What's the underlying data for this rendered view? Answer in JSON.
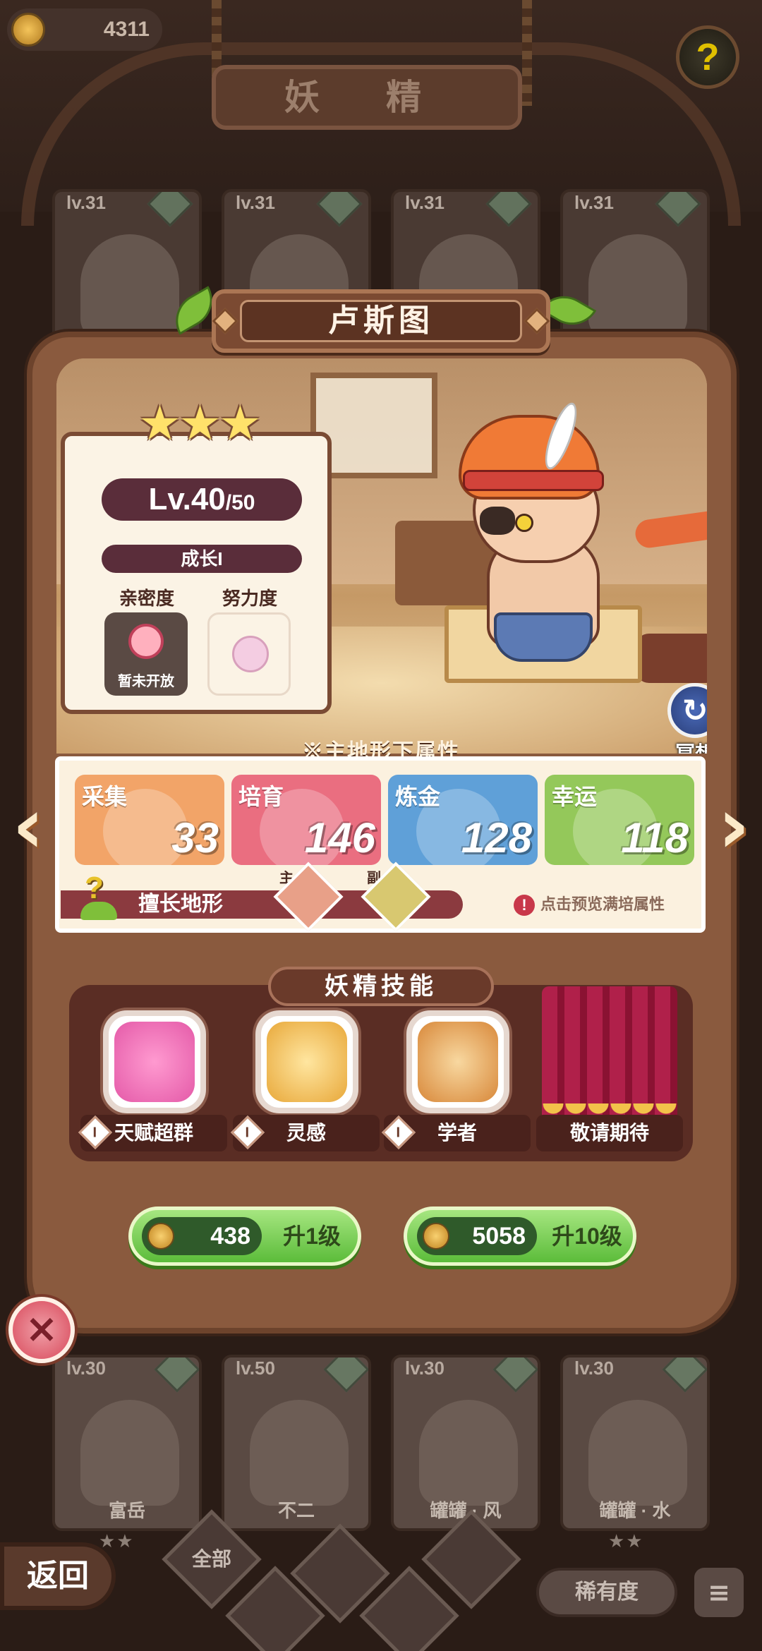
{
  "header": {
    "coins": "4311",
    "title": "妖 精",
    "help_icon": "question-sprout-icon"
  },
  "background_cards_top": [
    {
      "level": "lv.31"
    },
    {
      "level": "lv.31"
    },
    {
      "level": "lv.31"
    },
    {
      "level": "lv.31"
    }
  ],
  "background_cards_bottom": [
    {
      "level": "lv.30",
      "name": "富岳"
    },
    {
      "level": "lv.50",
      "name": "不二"
    },
    {
      "level": "lv.30",
      "name": "罐罐 · 风"
    },
    {
      "level": "lv.30",
      "name": "罐罐 · 水"
    }
  ],
  "fairy": {
    "name": "卢斯图",
    "stars": 3,
    "level_current": "Lv.40",
    "level_max": "/50",
    "growth_stage": "成长I",
    "intimacy_label": "亲密度",
    "intimacy_status": "暂未开放",
    "effort_label": "努力度",
    "meditate_label": "冥想"
  },
  "attributes": {
    "caption": "※主地形下属性",
    "items": [
      {
        "label": "采集",
        "value": "33",
        "color": "#f2a468"
      },
      {
        "label": "培育",
        "value": "146",
        "color": "#ea6e80"
      },
      {
        "label": "炼金",
        "value": "128",
        "color": "#5fa0d8"
      },
      {
        "label": "幸运",
        "value": "118",
        "color": "#94c85a"
      }
    ],
    "terrain_label": "擅长地形",
    "terrain_primary_tag": "主",
    "terrain_secondary_tag": "副",
    "preview_hint": "点击预览满培属性"
  },
  "skills": {
    "title": "妖精技能",
    "items": [
      {
        "level": "I",
        "name": "天赋超群"
      },
      {
        "level": "I",
        "name": "灵感"
      },
      {
        "level": "I",
        "name": "学者"
      },
      {
        "level": "",
        "name": "敬请期待"
      }
    ]
  },
  "upgrade": [
    {
      "cost": "438",
      "label": "升1级"
    },
    {
      "cost": "5058",
      "label": "升10级"
    }
  ],
  "bottom_nav": {
    "back_label": "返回",
    "filter_all": "全部",
    "rarity_label": "稀有度"
  },
  "colors": {
    "accent": "#8a5a3e",
    "upgrade_green": "#5cbc3a",
    "close_red": "#d8485a"
  }
}
